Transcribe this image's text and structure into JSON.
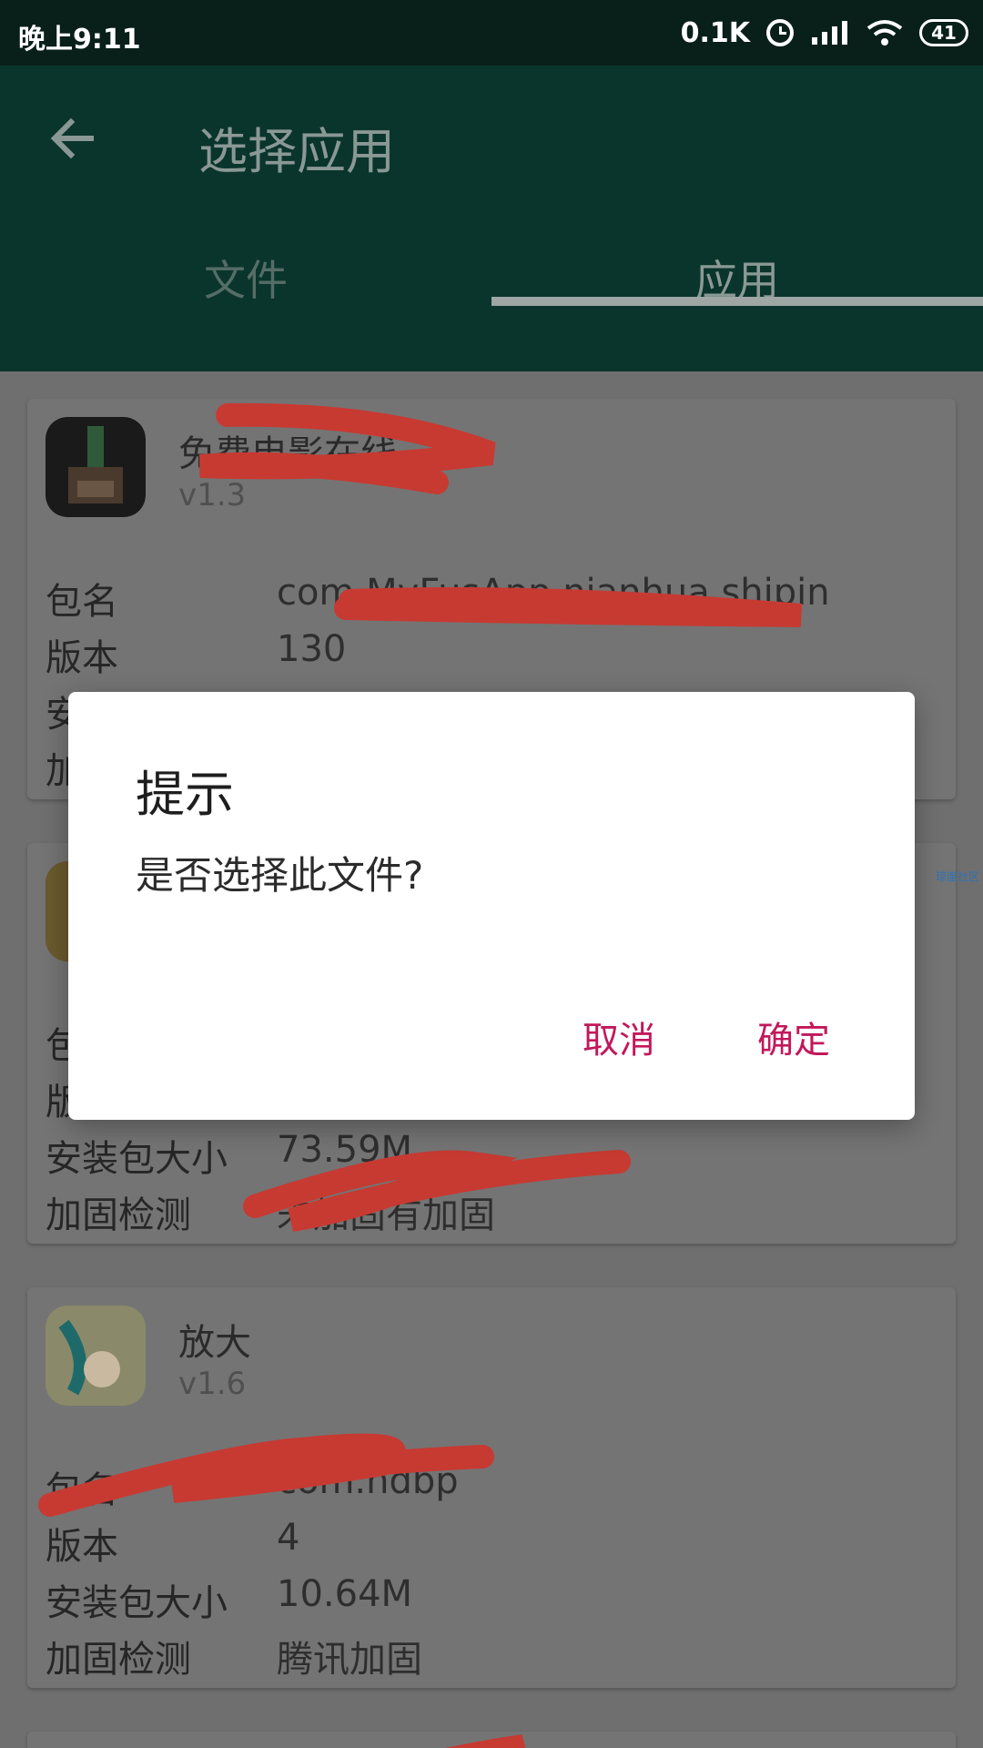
{
  "status_bar": {
    "time": "晚上9:11",
    "speed": "0.1K",
    "battery": "41"
  },
  "app_bar": {
    "title": "选择应用"
  },
  "tabs": [
    {
      "label": "文件"
    },
    {
      "label": "应用"
    }
  ],
  "labels": {
    "package": "包名",
    "version": "版本",
    "size": "安装包大小",
    "hardening": "加固检测"
  },
  "cards": [
    {
      "name": "免费电影在线",
      "version": "v1.3",
      "package": "com.MyFusApp.nianhua.shipin",
      "version_code": "130",
      "size": "",
      "hardening": ""
    },
    {
      "name": "",
      "version": "",
      "package": "",
      "version_code": "",
      "size": "73.59M",
      "hardening": "未加固有加固"
    },
    {
      "name": "放大",
      "version": "v1.6",
      "package": "com.hdbp",
      "version_code": "4",
      "size": "10.64M",
      "hardening": "腾讯加固"
    }
  ],
  "watermark": "琼崖社区",
  "dialog": {
    "title": "提示",
    "message": "是否选择此文件?",
    "cancel": "取消",
    "confirm": "确定"
  },
  "colors": {
    "app_bar": "#0a352c",
    "status_bar": "#091f1a",
    "dialog_button": "#c2185b",
    "scribble": "#e53935"
  }
}
